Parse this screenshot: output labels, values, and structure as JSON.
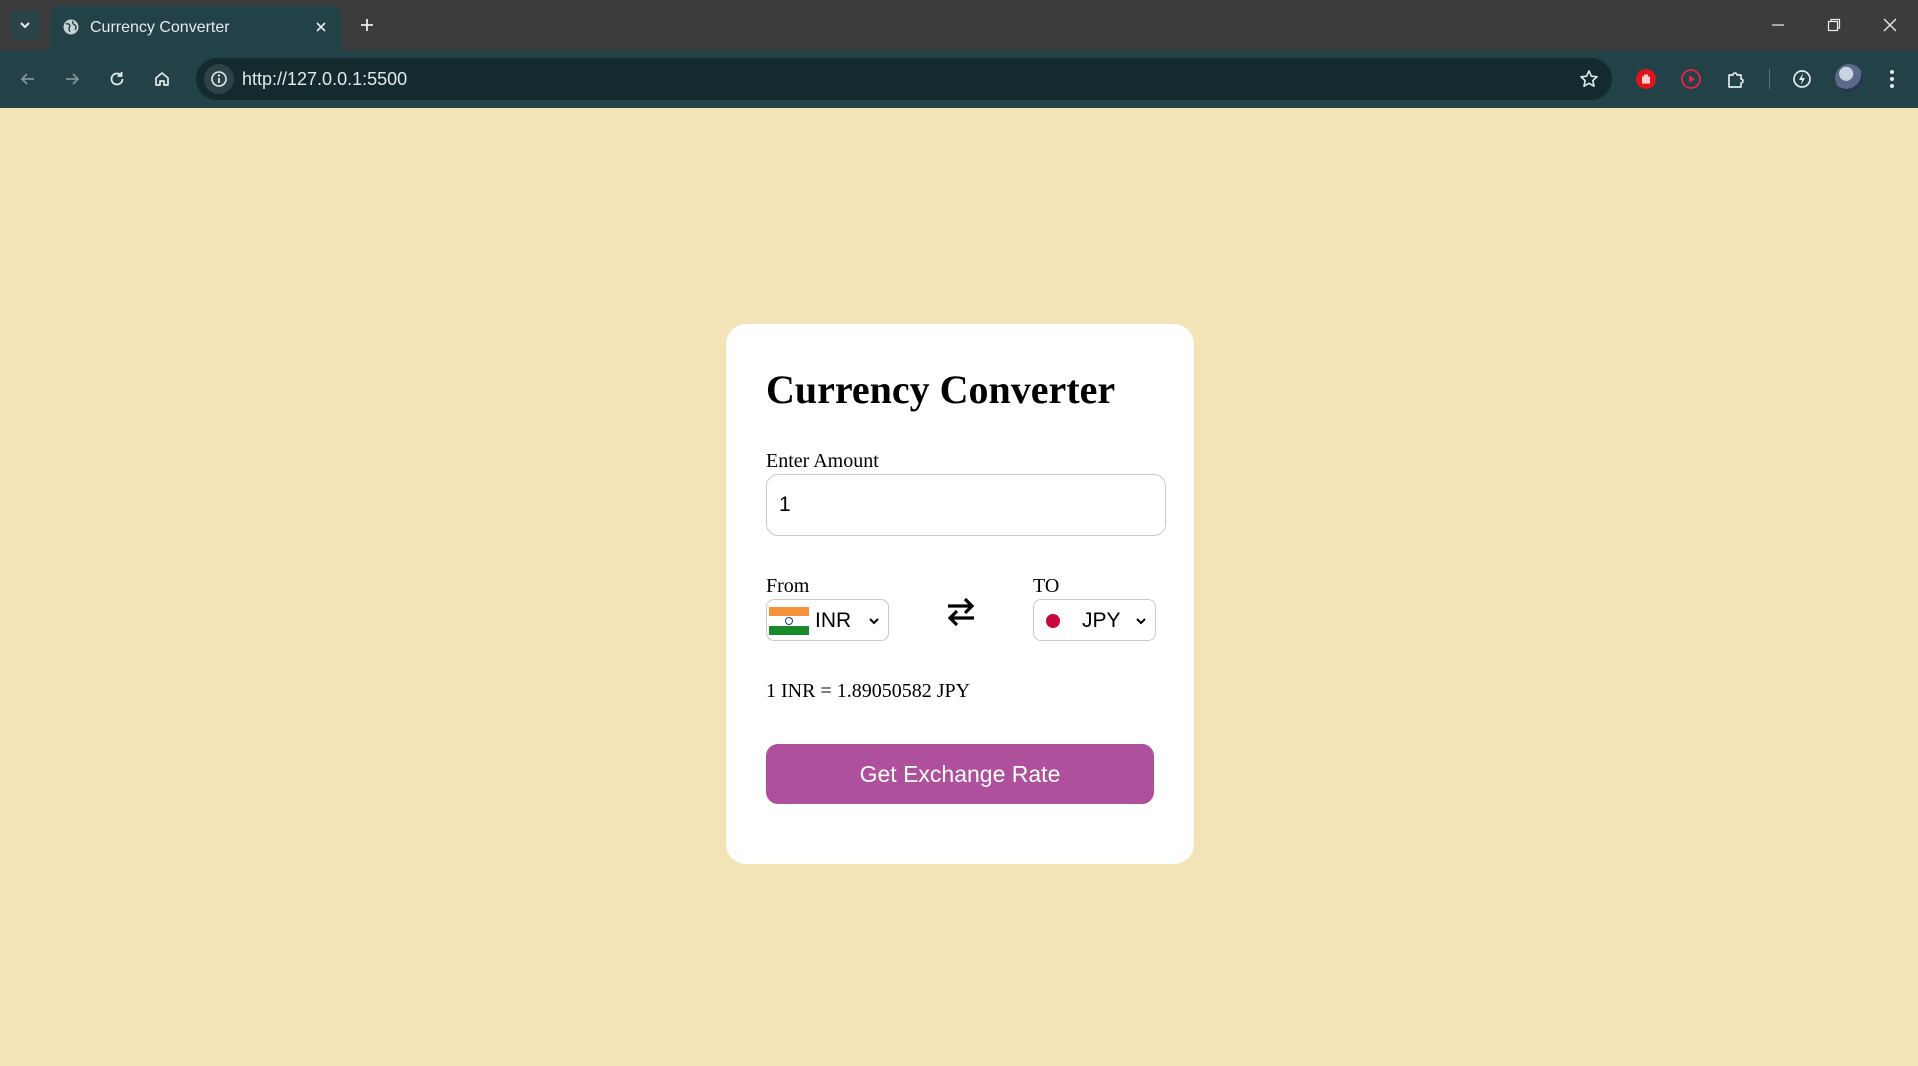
{
  "browser": {
    "tab_title": "Currency Converter",
    "url": "http://127.0.0.1:5500"
  },
  "icons": {
    "tab_list": "chevron-down-icon",
    "favicon": "globe-icon",
    "tab_close": "close-icon",
    "new_tab": "plus-icon",
    "back": "arrow-left-icon",
    "forward": "arrow-right-icon",
    "reload": "reload-icon",
    "home": "home-icon",
    "site_info": "info-icon",
    "bookmark": "star-icon",
    "extensions": "puzzle-icon",
    "swap": "swap-arrows-icon",
    "menu": "kebab-menu-icon"
  },
  "colors": {
    "page_background": "#f3e3b6",
    "card_background": "#ffffff",
    "button_background": "#ae509b",
    "browser_toolbar": "#224247"
  },
  "converter": {
    "title": "Currency Converter",
    "amount_label": "Enter Amount",
    "amount_value": "1",
    "from_label": "From",
    "from_currency": "INR",
    "to_label": "TO",
    "to_currency": "JPY",
    "result": "1 INR = 1.89050582 JPY",
    "button_label": "Get Exchange Rate"
  }
}
